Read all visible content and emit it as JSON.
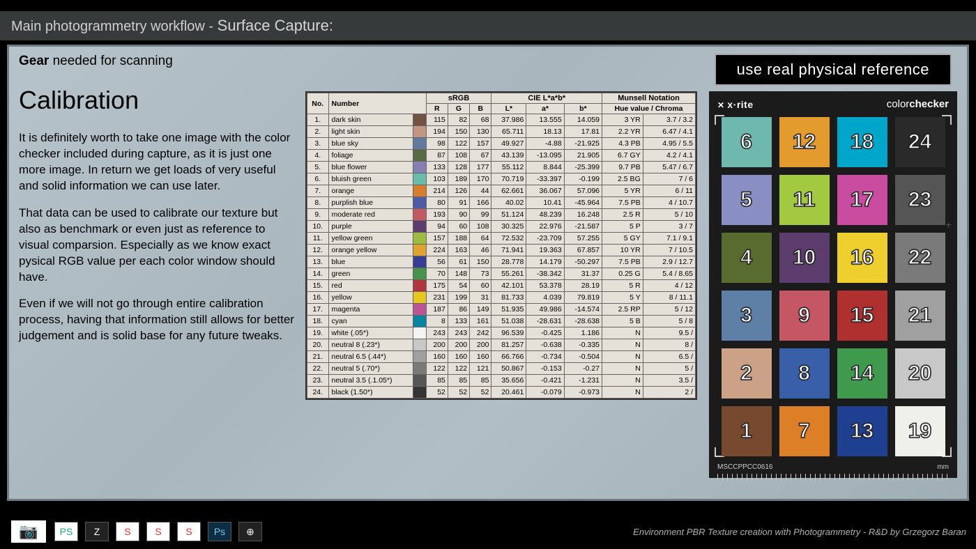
{
  "header": {
    "prefix": "Main photogrammetry workflow - ",
    "emph": "Surface Capture:"
  },
  "gear": {
    "bold": "Gear",
    "rest": " needed for scanning"
  },
  "title": "Calibration",
  "badge": "use real physical reference",
  "para1": "It is definitely worth to take one image with the color checker included during capture, as it is just one more image. In return we get loads of very useful and solid information we can use later.",
  "para2": "That data can be used to calibrate our texture but also as benchmark or even just as reference to visual comparsion. Especially as we know exact pysical RGB value per each color window should have.",
  "para3": "Even if we will not go through entire calibration process, having that information still allows for better judgement and is solid base for any future tweaks.",
  "footer_text": "Environment PBR Texture creation with Photogrammetry  - R&D by Grzegorz Baran",
  "checker": {
    "brand_left": "x·rite",
    "brand_right_light": "color",
    "brand_right_bold": "checker",
    "code": "MSCCPPCC0616",
    "mm": "mm",
    "patches": [
      {
        "n": 6,
        "c": "#6fb8ad"
      },
      {
        "n": 12,
        "c": "#e49b2e"
      },
      {
        "n": 18,
        "c": "#00a6c9"
      },
      {
        "n": 24,
        "c": "#2a2a2a"
      },
      {
        "n": 5,
        "c": "#8a8fc3"
      },
      {
        "n": 11,
        "c": "#a3c940"
      },
      {
        "n": 17,
        "c": "#c94ca0"
      },
      {
        "n": 23,
        "c": "#555555"
      },
      {
        "n": 4,
        "c": "#5a6b2f"
      },
      {
        "n": 10,
        "c": "#5d3c6e"
      },
      {
        "n": 16,
        "c": "#eecf2d"
      },
      {
        "n": 22,
        "c": "#7a7a7a"
      },
      {
        "n": 3,
        "c": "#5e7fa6"
      },
      {
        "n": 9,
        "c": "#c55663"
      },
      {
        "n": 15,
        "c": "#b02f2f"
      },
      {
        "n": 21,
        "c": "#a0a0a0"
      },
      {
        "n": 2,
        "c": "#cba188"
      },
      {
        "n": 8,
        "c": "#385fa8"
      },
      {
        "n": 14,
        "c": "#3f9a4e"
      },
      {
        "n": 20,
        "c": "#c8c8c8"
      },
      {
        "n": 1,
        "c": "#774a2f"
      },
      {
        "n": 7,
        "c": "#dd7f26"
      },
      {
        "n": 13,
        "c": "#1f3f90"
      },
      {
        "n": 19,
        "c": "#f0f0ea"
      }
    ]
  },
  "chart_data": {
    "type": "table",
    "title": "ColorChecker reference values",
    "columns": [
      "No.",
      "Number",
      "swatch",
      "R",
      "G",
      "B",
      "L*",
      "a*",
      "b*",
      "Hue value",
      "Chroma"
    ],
    "group_headers": {
      "sRGB": [
        "R",
        "G",
        "B"
      ],
      "CIE L*a*b*": [
        "L*",
        "a*",
        "b*"
      ],
      "Munsell Notation": [
        "Hue value / Chroma"
      ]
    },
    "rows": [
      {
        "no": 1,
        "name": "dark skin",
        "rgb": [
          115,
          82,
          68
        ],
        "L": 37.986,
        "a": 13.555,
        "b": 14.059,
        "hue": "3 YR",
        "chroma": "3.7 / 3.2"
      },
      {
        "no": 2,
        "name": "light skin",
        "rgb": [
          194,
          150,
          130
        ],
        "L": 65.711,
        "a": 18.13,
        "b": 17.81,
        "hue": "2.2 YR",
        "chroma": "6.47 / 4.1"
      },
      {
        "no": 3,
        "name": "blue sky",
        "rgb": [
          98,
          122,
          157
        ],
        "L": 49.927,
        "a": -4.88,
        "b": -21.925,
        "hue": "4.3 PB",
        "chroma": "4.95 / 5.5"
      },
      {
        "no": 4,
        "name": "foliage",
        "rgb": [
          87,
          108,
          67
        ],
        "L": 43.139,
        "a": -13.095,
        "b": 21.905,
        "hue": "6.7 GY",
        "chroma": "4.2 / 4.1"
      },
      {
        "no": 5,
        "name": "blue flower",
        "rgb": [
          133,
          128,
          177
        ],
        "L": 55.112,
        "a": 8.844,
        "b": -25.399,
        "hue": "9.7 PB",
        "chroma": "5.47 / 6.7"
      },
      {
        "no": 6,
        "name": "bluish green",
        "rgb": [
          103,
          189,
          170
        ],
        "L": 70.719,
        "a": -33.397,
        "b": -0.199,
        "hue": "2.5 BG",
        "chroma": "7 / 6"
      },
      {
        "no": 7,
        "name": "orange",
        "rgb": [
          214,
          126,
          44
        ],
        "L": 62.661,
        "a": 36.067,
        "b": 57.096,
        "hue": "5 YR",
        "chroma": "6 / 11"
      },
      {
        "no": 8,
        "name": "purplish blue",
        "rgb": [
          80,
          91,
          166
        ],
        "L": 40.02,
        "a": 10.41,
        "b": -45.964,
        "hue": "7.5 PB",
        "chroma": "4 / 10.7"
      },
      {
        "no": 9,
        "name": "moderate red",
        "rgb": [
          193,
          90,
          99
        ],
        "L": 51.124,
        "a": 48.239,
        "b": 16.248,
        "hue": "2.5 R",
        "chroma": "5 / 10"
      },
      {
        "no": 10,
        "name": "purple",
        "rgb": [
          94,
          60,
          108
        ],
        "L": 30.325,
        "a": 22.976,
        "b": -21.587,
        "hue": "5 P",
        "chroma": "3 / 7"
      },
      {
        "no": 11,
        "name": "yellow green",
        "rgb": [
          157,
          188,
          64
        ],
        "L": 72.532,
        "a": -23.709,
        "b": 57.255,
        "hue": "5 GY",
        "chroma": "7.1 / 9.1"
      },
      {
        "no": 12,
        "name": "orange yellow",
        "rgb": [
          224,
          163,
          46
        ],
        "L": 71.941,
        "a": 19.363,
        "b": 67.857,
        "hue": "10 YR",
        "chroma": "7 / 10.5"
      },
      {
        "no": 13,
        "name": "blue",
        "rgb": [
          56,
          61,
          150
        ],
        "L": 28.778,
        "a": 14.179,
        "b": -50.297,
        "hue": "7.5 PB",
        "chroma": "2.9 / 12.7"
      },
      {
        "no": 14,
        "name": "green",
        "rgb": [
          70,
          148,
          73
        ],
        "L": 55.261,
        "a": -38.342,
        "b": 31.37,
        "hue": "0.25 G",
        "chroma": "5.4 / 8.65"
      },
      {
        "no": 15,
        "name": "red",
        "rgb": [
          175,
          54,
          60
        ],
        "L": 42.101,
        "a": 53.378,
        "b": 28.19,
        "hue": "5 R",
        "chroma": "4 / 12"
      },
      {
        "no": 16,
        "name": "yellow",
        "rgb": [
          231,
          199,
          31
        ],
        "L": 81.733,
        "a": 4.039,
        "b": 79.819,
        "hue": "5 Y",
        "chroma": "8 / 11.1"
      },
      {
        "no": 17,
        "name": "magenta",
        "rgb": [
          187,
          86,
          149
        ],
        "L": 51.935,
        "a": 49.986,
        "b": -14.574,
        "hue": "2.5 RP",
        "chroma": "5 / 12"
      },
      {
        "no": 18,
        "name": "cyan",
        "rgb": [
          8,
          133,
          161
        ],
        "L": 51.038,
        "a": -28.631,
        "b": -28.638,
        "hue": "5 B",
        "chroma": "5 / 8"
      },
      {
        "no": 19,
        "name": "white (.05*)",
        "rgb": [
          243,
          243,
          242
        ],
        "L": 96.539,
        "a": -0.425,
        "b": 1.186,
        "hue": "N",
        "chroma": "9.5 /"
      },
      {
        "no": 20,
        "name": "neutral 8 (.23*)",
        "rgb": [
          200,
          200,
          200
        ],
        "L": 81.257,
        "a": -0.638,
        "b": -0.335,
        "hue": "N",
        "chroma": "8 /"
      },
      {
        "no": 21,
        "name": "neutral 6.5 (.44*)",
        "rgb": [
          160,
          160,
          160
        ],
        "L": 66.766,
        "a": -0.734,
        "b": -0.504,
        "hue": "N",
        "chroma": "6.5 /"
      },
      {
        "no": 22,
        "name": "neutral 5 (.70*)",
        "rgb": [
          122,
          122,
          121
        ],
        "L": 50.867,
        "a": -0.153,
        "b": -0.27,
        "hue": "N",
        "chroma": "5 /"
      },
      {
        "no": 23,
        "name": "neutral 3.5 (.1.05*)",
        "rgb": [
          85,
          85,
          85
        ],
        "L": 35.656,
        "a": -0.421,
        "b": -1.231,
        "hue": "N",
        "chroma": "3.5 /"
      },
      {
        "no": 24,
        "name": "black (1.50*)",
        "rgb": [
          52,
          52,
          52
        ],
        "L": 20.461,
        "a": -0.079,
        "b": -0.973,
        "hue": "N",
        "chroma": "2 /"
      }
    ]
  },
  "table_headers": {
    "no": "No.",
    "number": "Number",
    "srgb": "sRGB",
    "r": "R",
    "g": "G",
    "b": "B",
    "cielab": "CIE L*a*b*",
    "L": "L*",
    "a": "a*",
    "bb": "b*",
    "munsell": "Munsell Notation",
    "hue": "Hue value / Chroma"
  },
  "foot_icons": [
    "📷",
    "PS",
    "Z",
    "S",
    "S",
    "S",
    "Ps",
    "⊕"
  ]
}
